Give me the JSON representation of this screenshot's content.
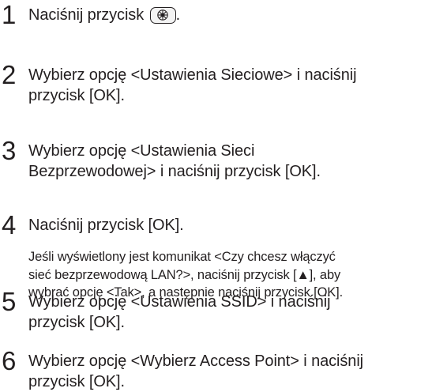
{
  "steps": [
    {
      "number": "1",
      "text_before_icon": "Naciśnij przycisk",
      "icon": "menu-key-icon",
      "text_after_icon": "."
    },
    {
      "number": "2",
      "lines": [
        "Wybierz opcję <Ustawienia Sieciowe> i naciśnij",
        "przycisk [OK]."
      ]
    },
    {
      "number": "3",
      "lines": [
        "Wybierz opcję <Ustawienia Sieci",
        "Bezprzewodowej> i naciśnij przycisk [OK]."
      ]
    },
    {
      "number": "4",
      "lines": [
        "Naciśnij przycisk [OK]."
      ],
      "note_lines": [
        "Jeśli wyświetlony jest komunikat <Czy chcesz włączyć",
        "sieć bezprzewodową LAN?>, naciśnij przycisk [▲], aby",
        "wybrać opcję <Tak>, a następnie naciśnij przycisk [OK]."
      ]
    },
    {
      "number": "5",
      "lines": [
        "Wybierz opcję <Ustawienia SSID> i naciśnij",
        "przycisk [OK]."
      ]
    },
    {
      "number": "6",
      "lines": [
        "Wybierz opcję <Wybierz Access Point> i naciśnij",
        "przycisk [OK]."
      ]
    }
  ]
}
